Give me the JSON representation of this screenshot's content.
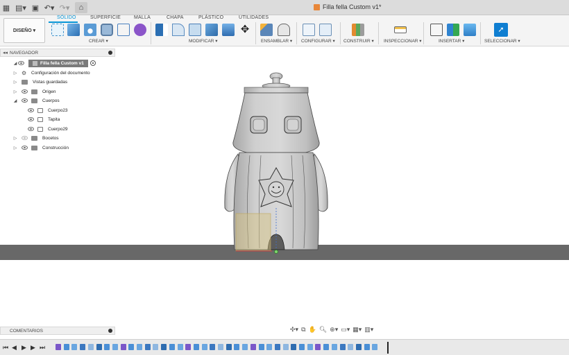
{
  "titlebar": {
    "document_title": "Filla fella Custom v1*",
    "icons": [
      "grid-icon",
      "file-menu-icon",
      "save-icon",
      "undo-icon",
      "redo-icon",
      "home-icon"
    ]
  },
  "ribbon": {
    "tabs": [
      {
        "label": "SÓLIDO",
        "active": true
      },
      {
        "label": "SUPERFICIE",
        "active": false
      },
      {
        "label": "MALLA",
        "active": false
      },
      {
        "label": "CHAPA",
        "active": false
      },
      {
        "label": "PLÁSTICO",
        "active": false
      },
      {
        "label": "UTILIDADES",
        "active": false
      }
    ],
    "workspace_button": "DISEÑO ▾",
    "groups": [
      {
        "label": "CREAR ▾"
      },
      {
        "label": "MODIFICAR ▾"
      },
      {
        "label": "ENSAMBLAR ▾"
      },
      {
        "label": "CONFIGURAR ▾"
      },
      {
        "label": "CONSTRUIR ▾"
      },
      {
        "label": "INSPECCIONAR ▾"
      },
      {
        "label": "INSERTAR ▾"
      },
      {
        "label": "SELECCIONAR ▾"
      }
    ],
    "accent_color": "#0696d7"
  },
  "navigator": {
    "title": "NAVEGADOR",
    "root": "Filla fella Custom v1",
    "items": [
      {
        "label": "Configuración del documento",
        "icon": "gear-icon"
      },
      {
        "label": "Vistas guardadas",
        "icon": "folder-icon"
      },
      {
        "label": "Origen",
        "icon": "folder-icon"
      },
      {
        "label": "Cuerpos",
        "icon": "folder-icon"
      },
      {
        "label": "Cuerpo23",
        "icon": "body-icon"
      },
      {
        "label": "Tapita",
        "icon": "body-icon"
      },
      {
        "label": "Cuerpo29",
        "icon": "body-icon"
      },
      {
        "label": "Bocetos",
        "icon": "folder-icon"
      },
      {
        "label": "Construcción",
        "icon": "folder-icon"
      }
    ]
  },
  "comments": {
    "title": "COMENTARIOS"
  }
}
